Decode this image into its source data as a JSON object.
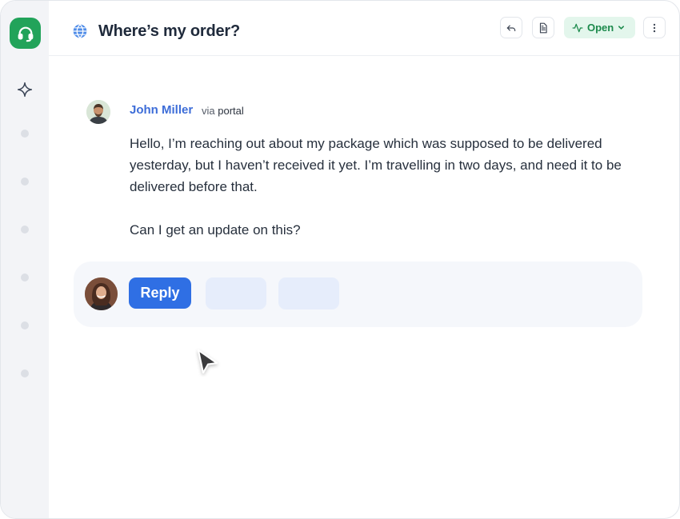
{
  "ticket": {
    "title": "Where’s my order?",
    "status_label": "Open"
  },
  "message": {
    "author": "John Miller",
    "via_prefix": "via",
    "channel": "portal",
    "paragraphs": [
      "Hello, I’m reaching out about my package which was supposed to be delivered yesterday, but I haven’t received it yet. I’m travelling in two days, and need it to be delivered before that.",
      "Can I get an update on this?"
    ]
  },
  "composer": {
    "reply_label": "Reply"
  },
  "sidebar": {
    "nav_dot_count": 6
  },
  "icons": {
    "logo": "headset-icon",
    "ai": "sparkle-icon",
    "channel": "globe-icon",
    "back": "reply-arrow-icon",
    "notes": "document-icon",
    "status": "activity-icon",
    "menu": "more-vertical-icon",
    "pointer": "cursor-pointer-icon"
  },
  "colors": {
    "brand_green": "#22a35a",
    "accent_blue": "#2f6fe4",
    "author_blue": "#3d6dd8",
    "status_bg": "#e3f6ec",
    "status_fg": "#1c8a4c"
  }
}
